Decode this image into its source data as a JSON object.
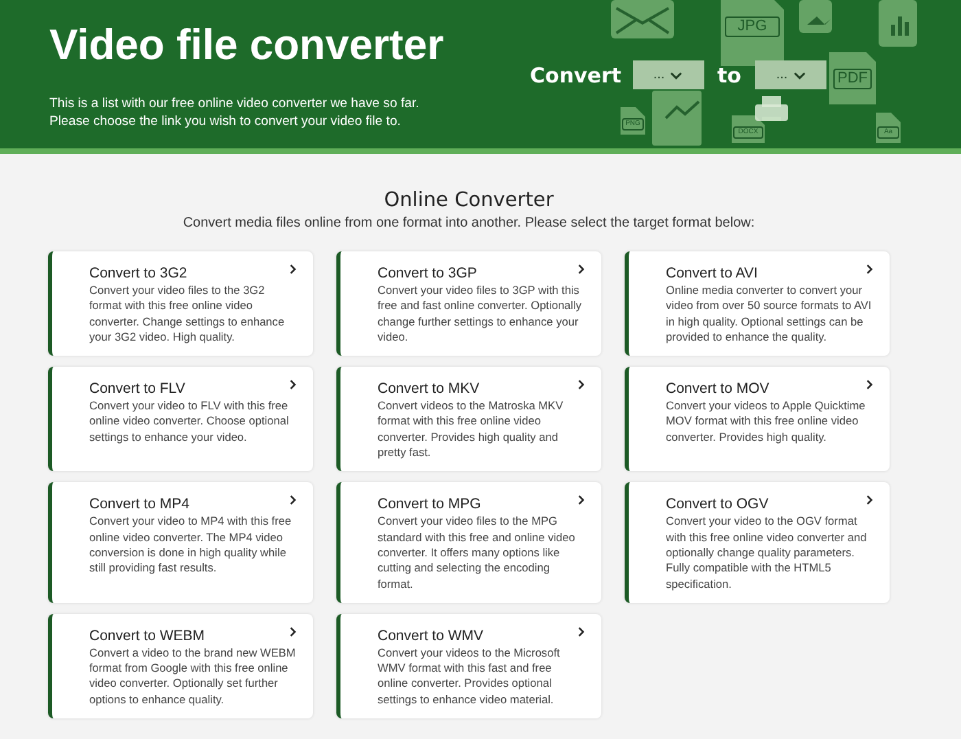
{
  "header": {
    "title": "Video file converter",
    "description": [
      "This is a list with our free online video converter we have so far.",
      "Please choose the link you wish to convert your video file to."
    ],
    "selector": {
      "label": "Convert",
      "from": "...",
      "joiner": "to",
      "to": "..."
    },
    "decor_icons": [
      {
        "kind": "mail"
      },
      {
        "kind": "file",
        "label": "JPG"
      },
      {
        "kind": "image"
      },
      {
        "kind": "chart"
      },
      {
        "kind": "file",
        "label": "PDF"
      },
      {
        "kind": "file",
        "label": "PNG"
      },
      {
        "kind": "trend"
      },
      {
        "kind": "file",
        "label": "DOCX"
      },
      {
        "kind": "file",
        "label": "Aa"
      },
      {
        "kind": "printer"
      }
    ]
  },
  "section": {
    "title": "Online Converter",
    "subtitle": "Convert media files online from one format into another. Please select the target format below:"
  },
  "cards": [
    {
      "title": "Convert to 3G2",
      "text": "Convert your video files to the 3G2 format with this free online video converter. Change settings to enhance your 3G2 video. High quality."
    },
    {
      "title": "Convert to 3GP",
      "text": "Convert your video files to 3GP with this free and fast online converter. Optionally change further settings to enhance your video."
    },
    {
      "title": "Convert to AVI",
      "text": "Online media converter to convert your video from over 50 source formats to AVI in high quality. Optional settings can be provided to enhance the quality."
    },
    {
      "title": "Convert to FLV",
      "text": "Convert your video to FLV with this free online video converter. Choose optional settings to enhance your video."
    },
    {
      "title": "Convert to MKV",
      "text": "Convert videos to the Matroska MKV format with this free online video converter. Provides high quality and pretty fast."
    },
    {
      "title": "Convert to MOV",
      "text": "Convert your videos to Apple Quicktime MOV format with this free online video converter. Provides high quality."
    },
    {
      "title": "Convert to MP4",
      "text": "Convert your video to MP4 with this free online video converter. The MP4 video conversion is done in high quality while still providing fast results."
    },
    {
      "title": "Convert to MPG",
      "text": "Convert your video files to the MPG standard with this free and online video converter. It offers many options like cutting and selecting the encoding format."
    },
    {
      "title": "Convert to OGV",
      "text": "Convert your video to the OGV format with this free online video converter and optionally change quality parameters. Fully compatible with the HTML5 specification."
    },
    {
      "title": "Convert to WEBM",
      "text": "Convert a video to the brand new WEBM format from Google with this free online video converter. Optionally set further options to enhance quality."
    },
    {
      "title": "Convert to WMV",
      "text": "Convert your videos to the Microsoft WMV format with this fast and free online converter. Provides optional settings to enhance video material."
    }
  ]
}
